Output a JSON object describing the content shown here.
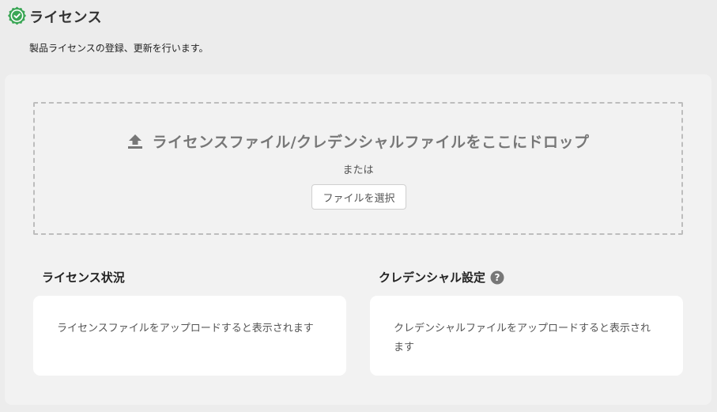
{
  "header": {
    "title": "ライセンス",
    "subtitle": "製品ライセンスの登録、更新を行います。",
    "icon": "check-badge-icon"
  },
  "dropzone": {
    "icon": "upload-icon",
    "main_text": "ライセンスファイル/クレデンシャルファイルをここにドロップ",
    "or_text": "または",
    "select_button_label": "ファイルを選択"
  },
  "license_status": {
    "title": "ライセンス状況",
    "message": "ライセンスファイルをアップロードすると表示されます"
  },
  "credential_settings": {
    "title": "クレデンシャル設定",
    "help_icon": "question-circle-icon",
    "message": "クレデンシャルファイルをアップロードすると表示されます"
  },
  "colors": {
    "accent_green": "#3aa655",
    "background": "#ececec",
    "panel": "#f2f2f2"
  }
}
